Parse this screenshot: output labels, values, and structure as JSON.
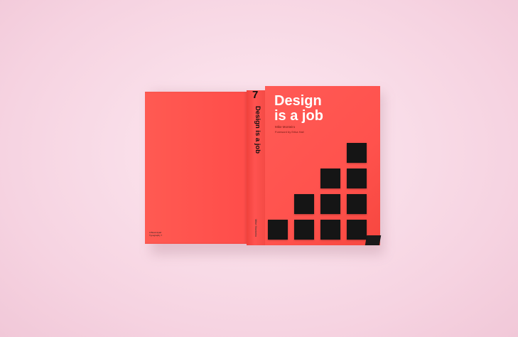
{
  "book": {
    "spine_number": "7",
    "spine_title": "Design is a job",
    "spine_author": "Mike Monteiro",
    "title_line1": "Design",
    "title_line2": "is a job",
    "author": "Mike Monteiro",
    "subtitle": "Foreword by Erika Hall",
    "back_text_line1": "A Book Apart",
    "back_text_line2": "Typography 7",
    "cover_color": "#ff5550",
    "square_color": "#151515"
  }
}
